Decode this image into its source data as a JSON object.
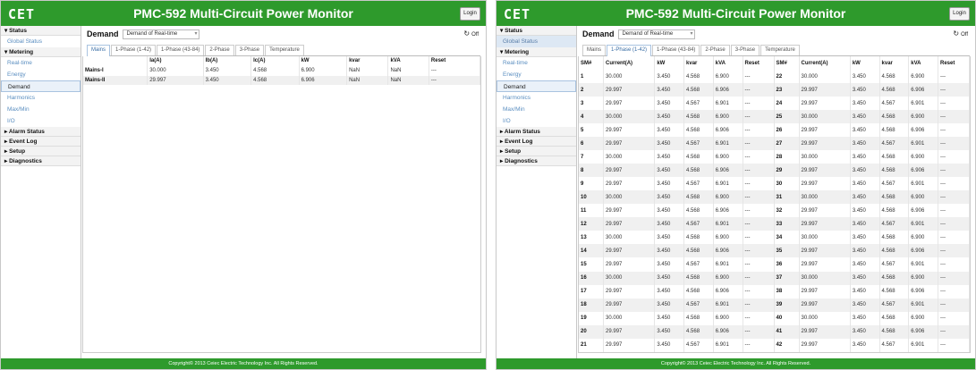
{
  "app": {
    "logo": "CET",
    "title": "PMC-592 Multi-Circuit Power Monitor",
    "login_label": "Login",
    "footer": "Copyright© 2013 Ceiec Electric Technology Inc. All Rights Reserved."
  },
  "sidebar": {
    "status": "▾ Status",
    "global_status": "Global Status",
    "metering": "▾ Metering",
    "items": [
      "Real-time",
      "Energy",
      "Demand",
      "Harmonics",
      "Max/Min",
      "I/O"
    ],
    "alarm": "▸ Alarm Status",
    "event": "▸ Event Log",
    "setup": "▸ Setup",
    "diagnostics": "▸ Diagnostics"
  },
  "toolbar": {
    "label": "Demand",
    "select_value": "Demand of Real-time",
    "refresh_label": "Off"
  },
  "tabs": [
    "Mains",
    "1-Phase (1-42)",
    "1-Phase (43-84)",
    "2-Phase",
    "3-Phase",
    "Temperature"
  ],
  "mains": {
    "headers": [
      "",
      "Ia(A)",
      "Ib(A)",
      "Ic(A)",
      "kW",
      "kvar",
      "kVA",
      "Reset"
    ],
    "rows": [
      [
        "Mains-I",
        "30.000",
        "3.450",
        "4.568",
        "6.900",
        "NaN",
        "NaN",
        "---"
      ],
      [
        "Mains-II",
        "29.997",
        "3.450",
        "4.568",
        "6.906",
        "NaN",
        "NaN",
        "---"
      ]
    ]
  },
  "phase1": {
    "headers": [
      "SM#",
      "Current(A)",
      "kW",
      "kvar",
      "kVA",
      "Reset"
    ],
    "left_rows": [
      [
        "1",
        "30.000",
        "3.450",
        "4.568",
        "6.900",
        "---"
      ],
      [
        "2",
        "29.997",
        "3.450",
        "4.568",
        "6.906",
        "---"
      ],
      [
        "3",
        "29.997",
        "3.450",
        "4.567",
        "6.901",
        "---"
      ],
      [
        "4",
        "30.000",
        "3.450",
        "4.568",
        "6.900",
        "---"
      ],
      [
        "5",
        "29.997",
        "3.450",
        "4.568",
        "6.906",
        "---"
      ],
      [
        "6",
        "29.997",
        "3.450",
        "4.567",
        "6.901",
        "---"
      ],
      [
        "7",
        "30.000",
        "3.450",
        "4.568",
        "6.900",
        "---"
      ],
      [
        "8",
        "29.997",
        "3.450",
        "4.568",
        "6.906",
        "---"
      ],
      [
        "9",
        "29.997",
        "3.450",
        "4.567",
        "6.901",
        "---"
      ],
      [
        "10",
        "30.000",
        "3.450",
        "4.568",
        "6.900",
        "---"
      ],
      [
        "11",
        "29.997",
        "3.450",
        "4.568",
        "6.906",
        "---"
      ],
      [
        "12",
        "29.997",
        "3.450",
        "4.567",
        "6.901",
        "---"
      ],
      [
        "13",
        "30.000",
        "3.450",
        "4.568",
        "6.900",
        "---"
      ],
      [
        "14",
        "29.997",
        "3.450",
        "4.568",
        "6.906",
        "---"
      ],
      [
        "15",
        "29.997",
        "3.450",
        "4.567",
        "6.901",
        "---"
      ],
      [
        "16",
        "30.000",
        "3.450",
        "4.568",
        "6.900",
        "---"
      ],
      [
        "17",
        "29.997",
        "3.450",
        "4.568",
        "6.906",
        "---"
      ],
      [
        "18",
        "29.997",
        "3.450",
        "4.567",
        "6.901",
        "---"
      ],
      [
        "19",
        "30.000",
        "3.450",
        "4.568",
        "6.900",
        "---"
      ],
      [
        "20",
        "29.997",
        "3.450",
        "4.568",
        "6.906",
        "---"
      ],
      [
        "21",
        "29.997",
        "3.450",
        "4.567",
        "6.901",
        "---"
      ]
    ],
    "right_rows": [
      [
        "22",
        "30.000",
        "3.450",
        "4.568",
        "6.900",
        "---"
      ],
      [
        "23",
        "29.997",
        "3.450",
        "4.568",
        "6.906",
        "---"
      ],
      [
        "24",
        "29.997",
        "3.450",
        "4.567",
        "6.901",
        "---"
      ],
      [
        "25",
        "30.000",
        "3.450",
        "4.568",
        "6.900",
        "---"
      ],
      [
        "26",
        "29.997",
        "3.450",
        "4.568",
        "6.906",
        "---"
      ],
      [
        "27",
        "29.997",
        "3.450",
        "4.567",
        "6.901",
        "---"
      ],
      [
        "28",
        "30.000",
        "3.450",
        "4.568",
        "6.900",
        "---"
      ],
      [
        "29",
        "29.997",
        "3.450",
        "4.568",
        "6.906",
        "---"
      ],
      [
        "30",
        "29.997",
        "3.450",
        "4.567",
        "6.901",
        "---"
      ],
      [
        "31",
        "30.000",
        "3.450",
        "4.568",
        "6.900",
        "---"
      ],
      [
        "32",
        "29.997",
        "3.450",
        "4.568",
        "6.906",
        "---"
      ],
      [
        "33",
        "29.997",
        "3.450",
        "4.567",
        "6.901",
        "---"
      ],
      [
        "34",
        "30.000",
        "3.450",
        "4.568",
        "6.900",
        "---"
      ],
      [
        "35",
        "29.997",
        "3.450",
        "4.568",
        "6.906",
        "---"
      ],
      [
        "36",
        "29.997",
        "3.450",
        "4.567",
        "6.901",
        "---"
      ],
      [
        "37",
        "30.000",
        "3.450",
        "4.568",
        "6.900",
        "---"
      ],
      [
        "38",
        "29.997",
        "3.450",
        "4.568",
        "6.906",
        "---"
      ],
      [
        "39",
        "29.997",
        "3.450",
        "4.567",
        "6.901",
        "---"
      ],
      [
        "40",
        "30.000",
        "3.450",
        "4.568",
        "6.900",
        "---"
      ],
      [
        "41",
        "29.997",
        "3.450",
        "4.568",
        "6.906",
        "---"
      ],
      [
        "42",
        "29.997",
        "3.450",
        "4.567",
        "6.901",
        "---"
      ]
    ]
  },
  "colors": {
    "header_green": "#2e9a2c",
    "link_blue": "#5a8ec0"
  },
  "icons": {
    "refresh": "refresh-icon",
    "dropdown": "chevron-down-icon"
  }
}
